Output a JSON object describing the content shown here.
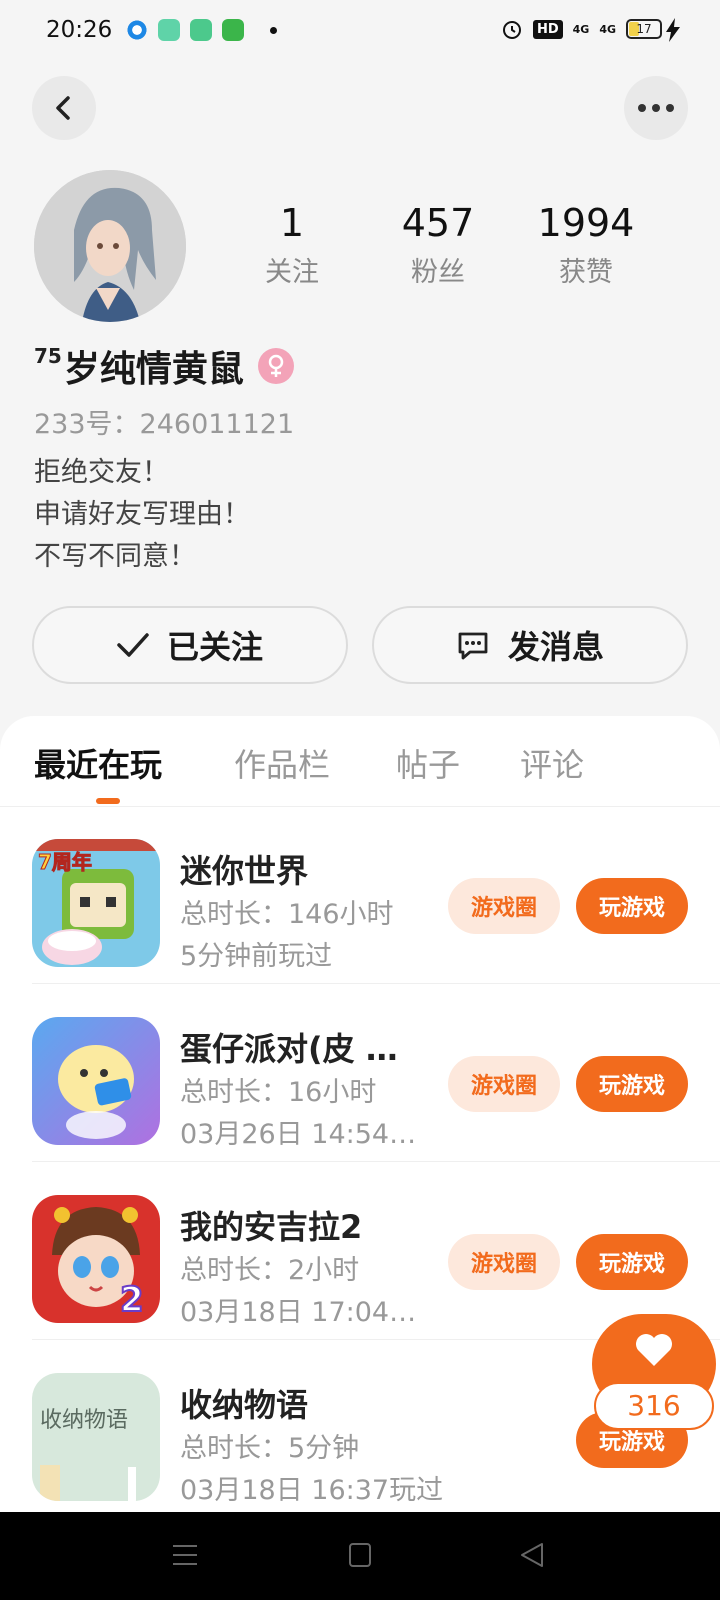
{
  "status_bar": {
    "time": "20:26",
    "hd_label": "HD",
    "signal1": "4G",
    "signal2": "4G",
    "battery": "17"
  },
  "profile": {
    "stats": [
      {
        "value": "1",
        "label": "关注"
      },
      {
        "value": "457",
        "label": "粉丝"
      },
      {
        "value": "1994",
        "label": "获赞"
      }
    ],
    "name_prefix": "75",
    "name": "岁纯情黄鼠",
    "uid": "233号：246011121",
    "bio": [
      "拒绝交友！",
      "申请好友写理由！",
      "不写不同意！"
    ],
    "follow_label": "已关注",
    "message_label": "发消息"
  },
  "tabs": [
    {
      "label": "最近在玩"
    },
    {
      "label": "作品栏"
    },
    {
      "label": "帖子"
    },
    {
      "label": "评论"
    }
  ],
  "games": [
    {
      "title": "迷你世界",
      "duration": "总时长：146小时",
      "last_played": "5分钟前玩过",
      "circle_label": "游戏圈",
      "play_label": "玩游戏",
      "icon": "mini-world-icon",
      "icon_badge": "7周年"
    },
    {
      "title": "蛋仔派对(皮 …",
      "duration": "总时长：16小时",
      "last_played": "03月26日 14:54…",
      "circle_label": "游戏圈",
      "play_label": "玩游戏",
      "icon": "eggy-party-icon"
    },
    {
      "title": "我的安吉拉2",
      "duration": "总时长：2小时",
      "last_played": "03月18日 17:04…",
      "circle_label": "游戏圈",
      "play_label": "玩游戏",
      "icon": "my-angela-2-icon",
      "icon_badge": "2"
    },
    {
      "title": "收纳物语",
      "duration": "总时长：5分钟",
      "last_played": "03月18日 16:37玩过",
      "play_label": "玩游戏",
      "icon": "storage-story-icon",
      "icon_text": "收纳物语"
    }
  ],
  "like_fab": {
    "count": "316"
  },
  "colors": {
    "accent": "#f26b1d",
    "accent_light": "#fde8dc",
    "gender": "#f3a3b8"
  }
}
